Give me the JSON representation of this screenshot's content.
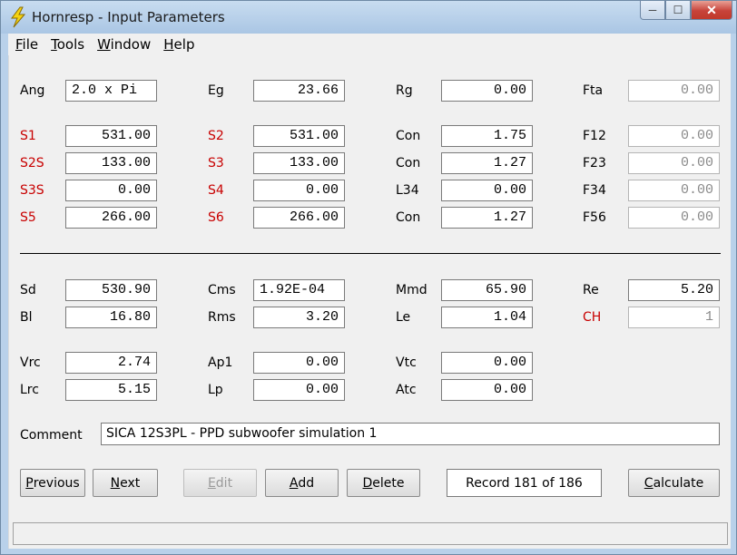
{
  "window": {
    "title": "Hornresp - Input Parameters",
    "minimize": "─",
    "maximize": "☐",
    "close": "✕"
  },
  "menu": [
    {
      "acc": "F",
      "rest": "ile"
    },
    {
      "acc": "T",
      "rest": "ools"
    },
    {
      "acc": "W",
      "rest": "indow"
    },
    {
      "acc": "H",
      "rest": "elp"
    }
  ],
  "fields": {
    "ang": {
      "label": "Ang",
      "value": "2.0 x Pi"
    },
    "eg": {
      "label": "Eg",
      "value": "23.66"
    },
    "rg": {
      "label": "Rg",
      "value": "0.00"
    },
    "fta": {
      "label": "Fta",
      "value": "0.00"
    },
    "s1": {
      "label": "S1",
      "value": "531.00"
    },
    "s2": {
      "label": "S2",
      "value": "531.00"
    },
    "con1": {
      "label": "Con",
      "value": "1.75"
    },
    "f12": {
      "label": "F12",
      "value": "0.00"
    },
    "s2s": {
      "label": "S2S",
      "value": "133.00"
    },
    "s3": {
      "label": "S3",
      "value": "133.00"
    },
    "con2": {
      "label": "Con",
      "value": "1.27"
    },
    "f23": {
      "label": "F23",
      "value": "0.00"
    },
    "s3s": {
      "label": "S3S",
      "value": "0.00"
    },
    "s4": {
      "label": "S4",
      "value": "0.00"
    },
    "l34": {
      "label": "L34",
      "value": "0.00"
    },
    "f34": {
      "label": "F34",
      "value": "0.00"
    },
    "s5": {
      "label": "S5",
      "value": "266.00"
    },
    "s6": {
      "label": "S6",
      "value": "266.00"
    },
    "con3": {
      "label": "Con",
      "value": "1.27"
    },
    "f56": {
      "label": "F56",
      "value": "0.00"
    },
    "sd": {
      "label": "Sd",
      "value": "530.90"
    },
    "cms": {
      "label": "Cms",
      "value": "1.92E-04"
    },
    "mmd": {
      "label": "Mmd",
      "value": "65.90"
    },
    "re": {
      "label": "Re",
      "value": "5.20"
    },
    "bl": {
      "label": "Bl",
      "value": "16.80"
    },
    "rms": {
      "label": "Rms",
      "value": "3.20"
    },
    "le": {
      "label": "Le",
      "value": "1.04"
    },
    "ch": {
      "label": "CH",
      "value": "1"
    },
    "vrc": {
      "label": "Vrc",
      "value": "2.74"
    },
    "ap1": {
      "label": "Ap1",
      "value": "0.00"
    },
    "vtc": {
      "label": "Vtc",
      "value": "0.00"
    },
    "lrc": {
      "label": "Lrc",
      "value": "5.15"
    },
    "lp": {
      "label": "Lp",
      "value": "0.00"
    },
    "atc": {
      "label": "Atc",
      "value": "0.00"
    }
  },
  "comment": {
    "label": "Comment",
    "value": "SICA 12S3PL - PPD subwoofer simulation 1"
  },
  "buttons": {
    "previous": {
      "acc": "P",
      "rest": "revious"
    },
    "next": {
      "acc": "N",
      "rest": "ext"
    },
    "edit": {
      "acc": "E",
      "rest": "dit"
    },
    "add": {
      "acc": "A",
      "rest": "dd"
    },
    "delete": {
      "acc": "D",
      "rest": "elete"
    },
    "calculate": {
      "acc": "C",
      "rest": "alculate"
    }
  },
  "record": "Record 181 of 186",
  "colors": {
    "required_label": "#c80000",
    "title_bar": "#b9d1ea",
    "close_button": "#c7433a"
  },
  "icons": {
    "app": "lightning-bolt-icon"
  }
}
